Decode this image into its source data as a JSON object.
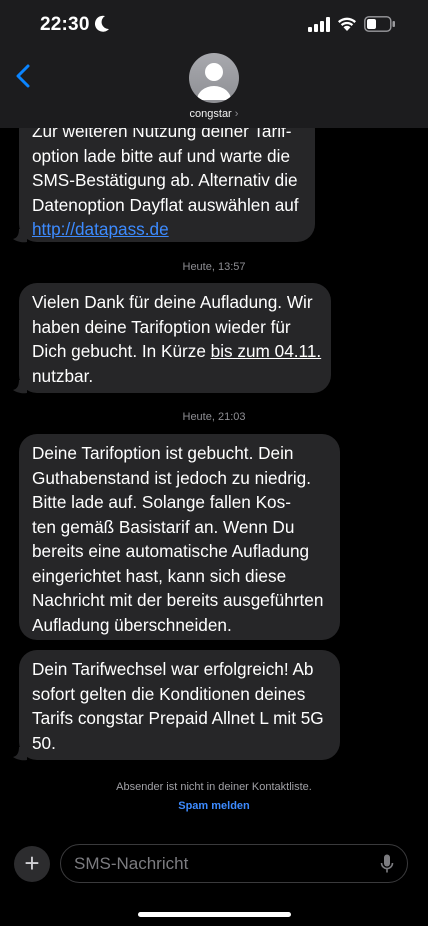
{
  "status_bar": {
    "time": "22:30"
  },
  "header": {
    "contact_name": "congstar",
    "contact_chevron": "›"
  },
  "messages": [
    {
      "lines": [
        "Zur weiteren Nutzung deiner Tarif-",
        "option lade bitte auf und warte die",
        "SMS-Bestätigung ab. Alternativ die",
        "Datenoption Dayflat auswählen auf"
      ],
      "link": "http://datapass.de"
    },
    {
      "timestamp": "Heute, 13:57",
      "lines": [
        "Vielen Dank für deine Aufladung. Wir",
        "haben deine Tarifoption wieder für"
      ],
      "line3_prefix": "Dich gebucht. In Kürze ",
      "line3_underlined": "bis zum 04.11.",
      "line4": "nutzbar."
    },
    {
      "timestamp": "Heute, 21:03",
      "lines": [
        "Deine Tarifoption ist gebucht. Dein",
        "Guthabenstand ist jedoch zu niedrig.",
        "Bitte lade auf. Solange fallen Kos-",
        "ten gemäß Basistarif an. Wenn Du",
        "bereits eine automatische Aufladung",
        "eingerichtet hast, kann sich diese",
        "Nachricht mit der bereits ausgeführten",
        "Aufladung überschneiden."
      ]
    },
    {
      "lines": [
        "Dein Tarifwechsel war erfolgreich! Ab",
        "sofort gelten die Konditionen deines",
        "Tarifs congstar Prepaid Allnet L mit 5G",
        "50."
      ]
    }
  ],
  "notice": "Absender ist nicht in deiner Kontaktliste.",
  "spam_link": "Spam melden",
  "compose": {
    "placeholder": "SMS-Nachricht",
    "plus_icon": "+"
  },
  "colors": {
    "bubble": "#262628",
    "link": "#3d8bff",
    "header": "#1c1c1e"
  }
}
